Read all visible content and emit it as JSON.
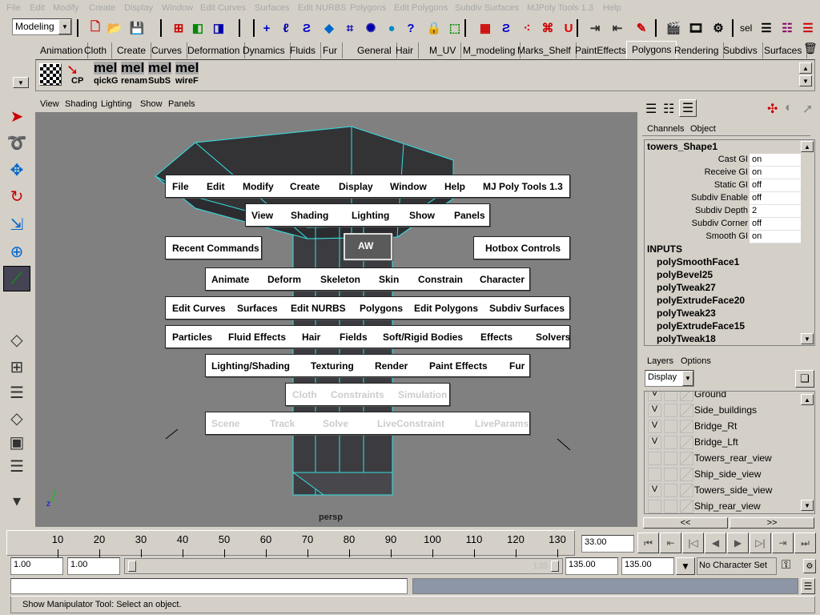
{
  "menubar": [
    "File",
    "Edit",
    "Modify",
    "Create",
    "Display",
    "Window",
    "Edit Curves",
    "Surfaces",
    "Edit NURBS",
    "Polygons",
    "Edit Polygons",
    "Subdiv Surfaces",
    "MJPoly Tools 1.3",
    "Help"
  ],
  "toolbar": {
    "mode": "Modeling",
    "sel_label": "sel"
  },
  "shelf_tabs": [
    "Animation",
    "Cloth",
    "Create",
    "Curves",
    "Deformation",
    "Dynamics",
    "Fluids",
    "Fur",
    "General",
    "Hair",
    "M_UV",
    "M_modeling",
    "Marks_Shelf",
    "PaintEffects",
    "Polygons",
    "Rendering",
    "Subdivs",
    "Surfaces"
  ],
  "shelf_active": "Polygons",
  "shelf_items": [
    "CP",
    "qickG",
    "renam",
    "SubS",
    "wireF"
  ],
  "shelf_mel": "mel",
  "viewport": {
    "menu": [
      "View",
      "Shading",
      "Lighting",
      "Show",
      "Panels"
    ],
    "camera": "persp",
    "wire_color": "#33e0e0"
  },
  "hotbox": {
    "main": [
      "File",
      "Edit",
      "Modify",
      "Create",
      "Display",
      "Window",
      "Help",
      "MJ Poly Tools 1.3"
    ],
    "panel": [
      "View",
      "Shading",
      "Lighting",
      "Show",
      "Panels"
    ],
    "recent": "Recent Commands",
    "controls": "Hotbox Controls",
    "center": "AW",
    "animation": [
      "Animate",
      "Deform",
      "Skeleton",
      "Skin",
      "Constrain",
      "Character"
    ],
    "modeling": [
      "Edit Curves",
      "Surfaces",
      "Edit NURBS",
      "Polygons",
      "Edit Polygons",
      "Subdiv Surfaces"
    ],
    "dynamics": [
      "Particles",
      "Fluid Effects",
      "Hair",
      "Fields",
      "Soft/Rigid Bodies",
      "Effects",
      "Solvers"
    ],
    "rendering": [
      "Lighting/Shading",
      "Texturing",
      "Render",
      "Paint Effects",
      "Fur"
    ],
    "cloth": [
      "Cloth",
      "Constraints",
      "Simulation"
    ],
    "live": [
      "Scene",
      "Track",
      "Solve",
      "LiveConstraint",
      "LiveParams"
    ]
  },
  "channels": {
    "menu": [
      "Channels",
      "Object"
    ],
    "object": "towers_Shape1",
    "attrs": [
      {
        "n": "Cast GI",
        "v": "on"
      },
      {
        "n": "Receive GI",
        "v": "on"
      },
      {
        "n": "Static GI",
        "v": "off"
      },
      {
        "n": "Subdiv Enable",
        "v": "off"
      },
      {
        "n": "Subdiv Depth",
        "v": "2"
      },
      {
        "n": "Subdiv Corner",
        "v": "off"
      },
      {
        "n": "Smooth GI",
        "v": "on"
      }
    ],
    "inputs_label": "INPUTS",
    "inputs": [
      "polySmoothFace1",
      "polyBevel25",
      "polyTweak27",
      "polyExtrudeFace20",
      "polyTweak23",
      "polyExtrudeFace15",
      "polyTweak18"
    ]
  },
  "layers": {
    "menu": [
      "Layers",
      "Options"
    ],
    "mode": "Display",
    "items": [
      {
        "v": "V",
        "name": "Ground"
      },
      {
        "v": "V",
        "name": "Side_buildings"
      },
      {
        "v": "V",
        "name": "Bridge_Rt"
      },
      {
        "v": "V",
        "name": "Bridge_Lft"
      },
      {
        "v": "",
        "name": "Towers_rear_view"
      },
      {
        "v": "",
        "name": "Ship_side_view"
      },
      {
        "v": "V",
        "name": "Towers_side_view"
      },
      {
        "v": "",
        "name": "Ship_rear_view"
      }
    ],
    "prev": "<<",
    "next": ">>"
  },
  "timeline": {
    "ticks": [
      "10",
      "20",
      "30",
      "40",
      "50",
      "60",
      "70",
      "80",
      "90",
      "100",
      "110",
      "120",
      "130"
    ],
    "current": "33.00"
  },
  "range": {
    "start": "1.00",
    "playstart": "1.00",
    "slider_end": "135",
    "playend": "135.00",
    "end": "135.00",
    "charset": "No Character Set"
  },
  "help_line": "Show Manipulator Tool: Select an object."
}
